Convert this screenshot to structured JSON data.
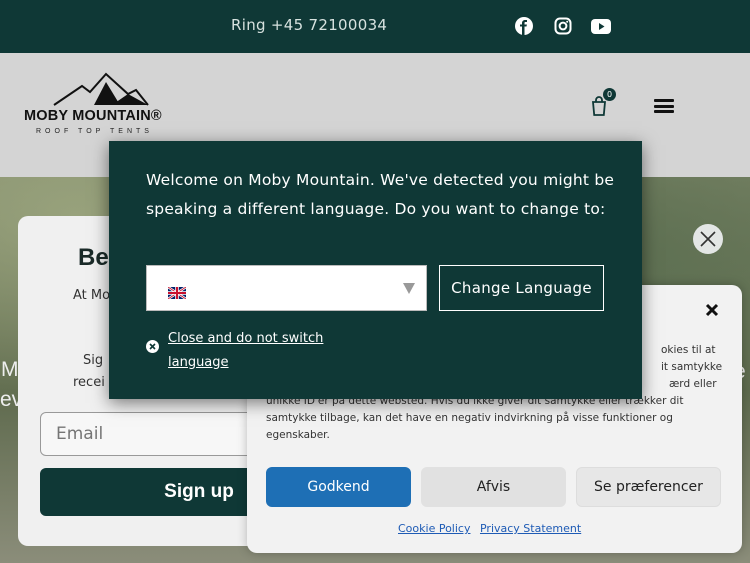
{
  "topbar": {
    "phone": "Ring +45 72100034",
    "social": [
      "facebook-icon",
      "instagram-icon",
      "youtube-icon"
    ]
  },
  "header": {
    "logo_name": "MOBY MOUNTAIN®",
    "logo_sub": "ROOF TOP TENTS",
    "cart_count": "0"
  },
  "hero": {
    "left_text_1": "M",
    "left_text_2": "ev",
    "right_text": "e"
  },
  "signup": {
    "title": "Be",
    "line1": "At Mo",
    "line2": "Sig",
    "line3": "recei",
    "email_placeholder": "Email",
    "button_label": "Sign up"
  },
  "language_popup": {
    "message": "Welcome on Moby Mountain. We've detected you might be speaking a different language. Do you want to change to:",
    "selected_language_flag": "uk-flag",
    "change_button": "Change Language",
    "close_link": "Close and do not switch language"
  },
  "cookie_banner": {
    "visible_text_1": "okies til at",
    "visible_text_2": "it samtykke",
    "visible_text_3": "ærd eller",
    "visible_text_4": "unikke ID'er på dette websted. Hvis du ikke giver dit samtykke eller trækker dit samtykke tilbage, kan det have en negativ indvirkning på visse funktioner og egenskaber.",
    "accept_label": "Godkend",
    "deny_label": "Afvis",
    "prefs_label": "Se præferencer",
    "link_cookie_policy": "Cookie Policy",
    "link_privacy": "Privacy Statement"
  },
  "colors": {
    "brand_dark": "#0f3836",
    "accept_blue": "#1e6fb5"
  }
}
